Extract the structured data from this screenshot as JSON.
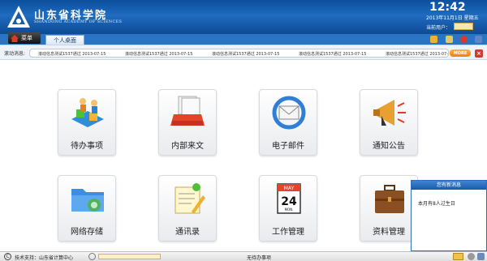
{
  "header": {
    "title_cn": "山东省科学院",
    "title_en": "SHANDONG ACADEMY OF SCIENCES",
    "clock": "12:42",
    "date": "2013年11月1日 星期五",
    "user_label": "当前用户："
  },
  "nav": {
    "menu_label": "菜单",
    "active_tab": "个人桌面"
  },
  "ticker": {
    "label": "滚动消息:",
    "items": [
      "滚动信息测试1537通过 2013-07-15",
      "滚动信息测试1537通过 2013-07-15",
      "滚动信息测试1537通过 2013-07-15",
      "滚动信息测试1537通过 2013-07-15",
      "滚动信息测试1537通过 2013-07-1"
    ],
    "more_label": "MORE"
  },
  "tiles": [
    {
      "label": "待办事项",
      "icon": "todo-people-icon"
    },
    {
      "label": "内部来文",
      "icon": "document-tray-icon"
    },
    {
      "label": "电子邮件",
      "icon": "email-sync-icon"
    },
    {
      "label": "通知公告",
      "icon": "megaphone-icon"
    },
    {
      "label": "网络存储",
      "icon": "network-folder-icon"
    },
    {
      "label": "通讯录",
      "icon": "address-book-icon"
    },
    {
      "label": "工作管理",
      "icon": "calendar-icon"
    },
    {
      "label": "资料管理",
      "icon": "briefcase-icon"
    }
  ],
  "calendar_icon": {
    "month": "MAY",
    "day": "24",
    "weekday": "MON."
  },
  "popup": {
    "title": "您有新消息",
    "message": "本月有8人过生日"
  },
  "footer": {
    "support": "技术支持：山东省计算中心",
    "no_todo": "无待办事项"
  },
  "colors": {
    "header_blue": "#0e4a94",
    "more_orange": "#f07f0a",
    "close_red": "#d23c2a"
  }
}
